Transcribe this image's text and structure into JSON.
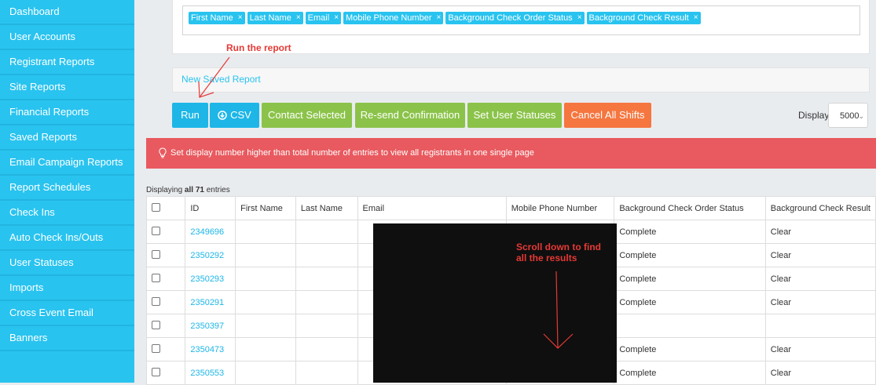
{
  "sidebar": {
    "items": [
      {
        "label": "Dashboard"
      },
      {
        "label": "User Accounts"
      },
      {
        "label": "Registrant Reports"
      },
      {
        "label": "Site Reports"
      },
      {
        "label": "Financial Reports"
      },
      {
        "label": "Saved Reports"
      },
      {
        "label": "Email Campaign Reports"
      },
      {
        "label": "Report Schedules"
      },
      {
        "label": "Check Ins"
      },
      {
        "label": "Auto Check Ins/Outs"
      },
      {
        "label": "User Statuses"
      },
      {
        "label": "Imports"
      },
      {
        "label": "Cross Event Email"
      },
      {
        "label": "Banners"
      }
    ]
  },
  "fields": {
    "tags": [
      "First Name",
      "Last Name",
      "Email",
      "Mobile Phone Number",
      "Background Check Order Status",
      "Background Check Result"
    ],
    "remove_glyph": "×"
  },
  "saved_report": {
    "link": "New Saved Report"
  },
  "toolbar": {
    "run": "Run",
    "csv": "CSV",
    "contact_selected": "Contact Selected",
    "resend": "Re-send Confirmation",
    "set_statuses": "Set User Statuses",
    "cancel_shifts": "Cancel All Shifts",
    "display_label": "Display",
    "display_value": "5000"
  },
  "alert": {
    "text": "Set display number higher than total number of entries to view all registrants in one single page",
    "color": "#e85a5f"
  },
  "entries": {
    "prefix": "Displaying ",
    "bold": "all 71",
    "suffix": " entries"
  },
  "table": {
    "headers": [
      "ID",
      "First Name",
      "Last Name",
      "Email",
      "Mobile Phone Number",
      "Background Check Order Status",
      "Background Check Result"
    ],
    "rows": [
      {
        "id": "2349696",
        "status": "Complete",
        "result": "Clear"
      },
      {
        "id": "2350292",
        "status": "Complete",
        "result": "Clear"
      },
      {
        "id": "2350293",
        "status": "Complete",
        "result": "Clear"
      },
      {
        "id": "2350291",
        "status": "Complete",
        "result": "Clear"
      },
      {
        "id": "2350397",
        "status": "",
        "result": ""
      },
      {
        "id": "2350473",
        "status": "Complete",
        "result": "Clear"
      },
      {
        "id": "2350553",
        "status": "Complete",
        "result": "Clear"
      }
    ]
  },
  "annotations": {
    "run_report": "Run the report",
    "scroll_line1": "Scroll down to find",
    "scroll_line2": "all the results"
  },
  "colors": {
    "sidebar": "#29c3ef",
    "primary": "#1eb6e7",
    "green": "#8bc34a",
    "orange": "#f5763f",
    "annotation": "#e53935"
  }
}
